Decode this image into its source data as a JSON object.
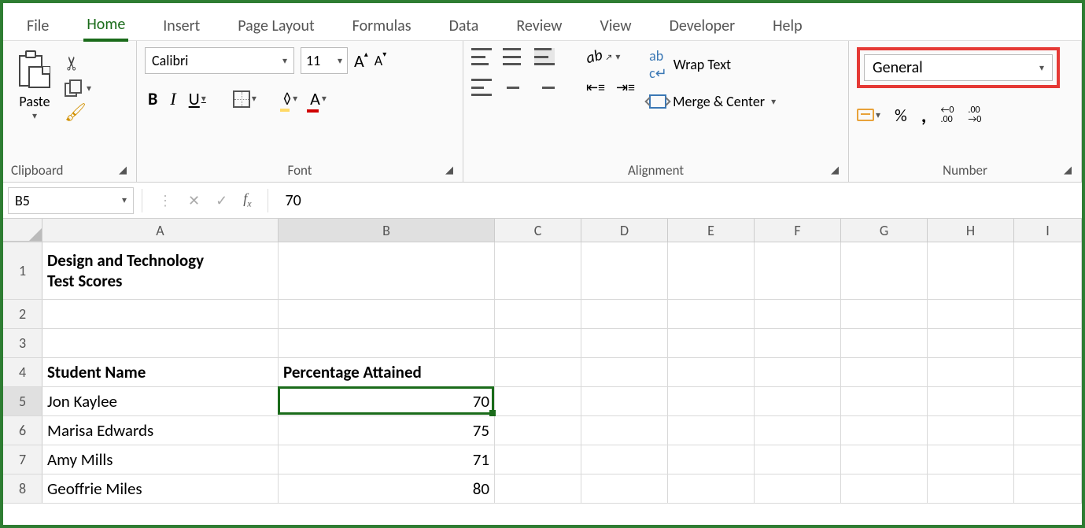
{
  "tabs": {
    "file": "File",
    "home": "Home",
    "insert": "Insert",
    "page_layout": "Page Layout",
    "formulas": "Formulas",
    "data": "Data",
    "review": "Review",
    "view": "View",
    "developer": "Developer",
    "help": "Help",
    "active": "Home"
  },
  "ribbon": {
    "clipboard": {
      "label": "Clipboard",
      "paste": "Paste"
    },
    "font": {
      "label": "Font",
      "name": "Calibri",
      "size": "11",
      "bold": "B",
      "italic": "I",
      "underline": "U",
      "increase_big": "A",
      "increase_small": "A"
    },
    "alignment": {
      "label": "Alignment",
      "wrap": "Wrap Text",
      "merge": "Merge & Center"
    },
    "number": {
      "label": "Number",
      "format": "General",
      "percent": "%",
      "comma": ",",
      "inc_dec": "←0\n.00",
      "dec_dec": ".00\n→0"
    }
  },
  "formula_bar": {
    "name_box": "B5",
    "fx": "fx",
    "value": "70"
  },
  "columns": [
    "A",
    "B",
    "C",
    "D",
    "E",
    "F",
    "G",
    "H",
    "I"
  ],
  "rows": {
    "1": {
      "A": "Design and Technology\nTest Scores",
      "B": ""
    },
    "2": {
      "A": "",
      "B": ""
    },
    "3": {
      "A": "",
      "B": ""
    },
    "4": {
      "A": "Student Name",
      "B": "Percentage Attained"
    },
    "5": {
      "A": "Jon Kaylee",
      "B": "70"
    },
    "6": {
      "A": "Marisa Edwards",
      "B": "75"
    },
    "7": {
      "A": "Amy Mills",
      "B": "71"
    },
    "8": {
      "A": "Geoffrie Miles",
      "B": "80"
    }
  },
  "selection": {
    "cell": "B5"
  }
}
